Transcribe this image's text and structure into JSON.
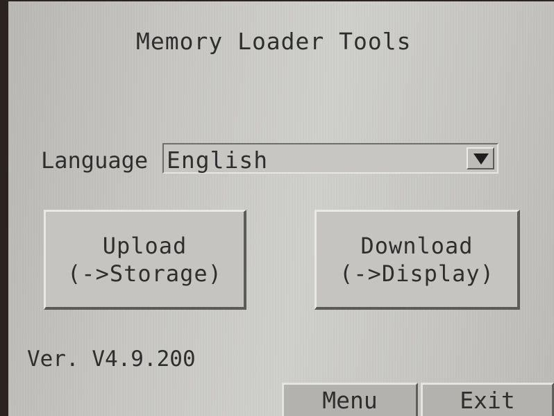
{
  "window": {
    "title": "Memory Loader Tools"
  },
  "language": {
    "label": "Language",
    "selected": "English",
    "dropdown_icon": "triangle-down-icon"
  },
  "actions": {
    "upload": {
      "line1": "Upload",
      "line2": "(->Storage)"
    },
    "download": {
      "line1": "Download",
      "line2": "(->Display)"
    }
  },
  "footer": {
    "version": "Ver. V4.9.200",
    "menu_label": "Menu",
    "exit_label": "Exit"
  }
}
